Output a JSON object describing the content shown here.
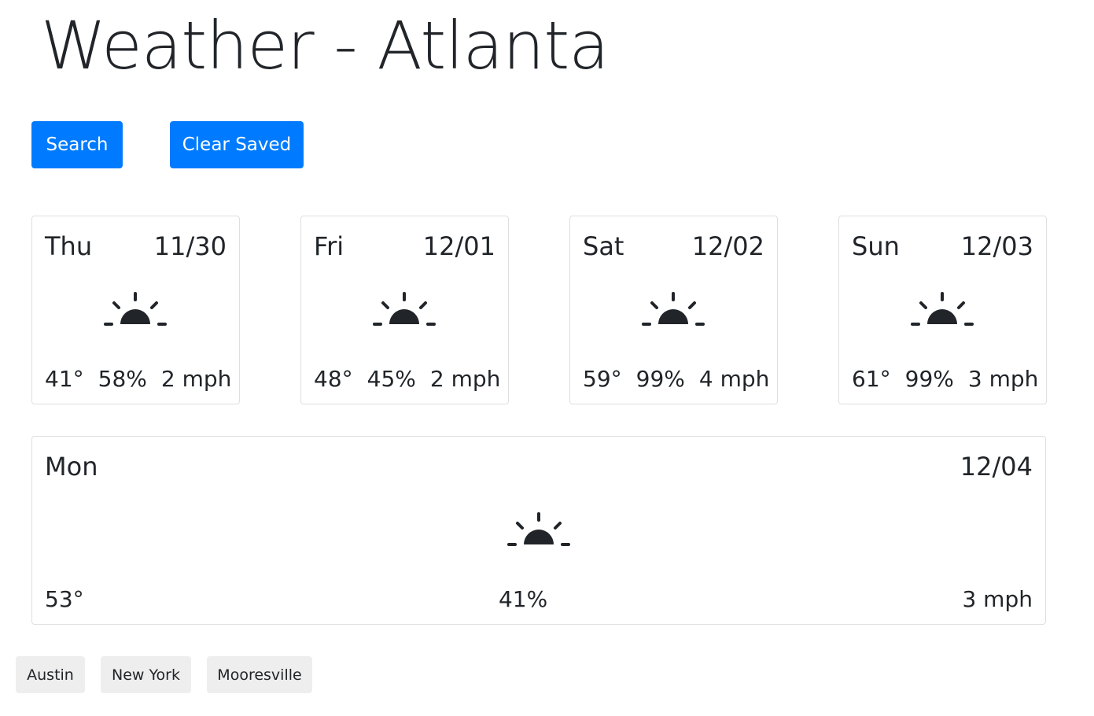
{
  "title": "Weather - Atlanta",
  "buttons": {
    "search": "Search",
    "clear_saved": "Clear Saved"
  },
  "forecast": [
    {
      "day": "Thu",
      "date": "11/30",
      "temp": "41°",
      "humidity": "58%",
      "wind": "2 mph",
      "icon": "sunrise-icon"
    },
    {
      "day": "Fri",
      "date": "12/01",
      "temp": "48°",
      "humidity": "45%",
      "wind": "2 mph",
      "icon": "sunrise-icon"
    },
    {
      "day": "Sat",
      "date": "12/02",
      "temp": "59°",
      "humidity": "99%",
      "wind": "4 mph",
      "icon": "sunrise-icon"
    },
    {
      "day": "Sun",
      "date": "12/03",
      "temp": "61°",
      "humidity": "99%",
      "wind": "3 mph",
      "icon": "sunrise-icon"
    },
    {
      "day": "Mon",
      "date": "12/04",
      "temp": "53°",
      "humidity": "41%",
      "wind": "3 mph",
      "icon": "sunrise-icon"
    }
  ],
  "saved_cities": [
    "Austin",
    "New York",
    "Mooresville"
  ],
  "colors": {
    "primary": "#007bff",
    "text": "#212529",
    "card_border": "#dfdfdf",
    "chip_bg": "#eeeeee"
  }
}
